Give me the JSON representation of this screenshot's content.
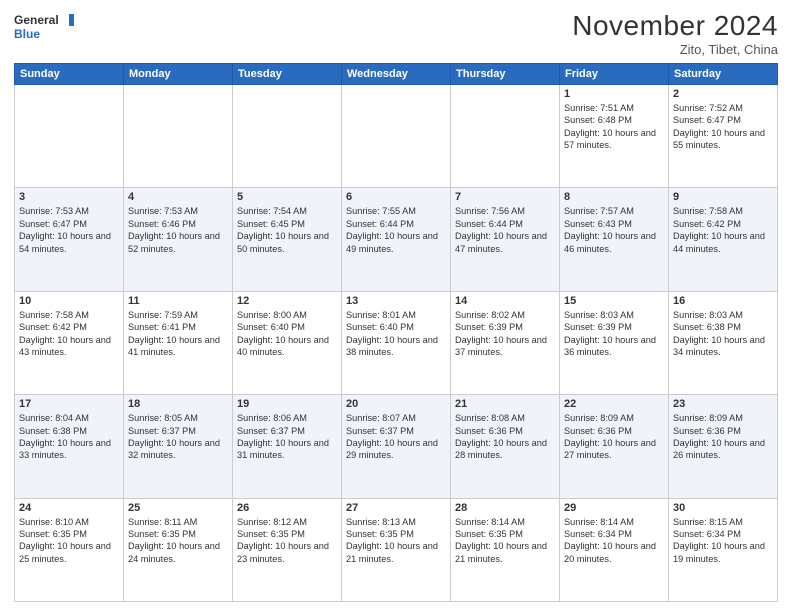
{
  "header": {
    "logo_line1": "General",
    "logo_line2": "Blue",
    "month_title": "November 2024",
    "location": "Zito, Tibet, China"
  },
  "days_of_week": [
    "Sunday",
    "Monday",
    "Tuesday",
    "Wednesday",
    "Thursday",
    "Friday",
    "Saturday"
  ],
  "weeks": [
    [
      {
        "day": "",
        "content": ""
      },
      {
        "day": "",
        "content": ""
      },
      {
        "day": "",
        "content": ""
      },
      {
        "day": "",
        "content": ""
      },
      {
        "day": "",
        "content": ""
      },
      {
        "day": "1",
        "content": "Sunrise: 7:51 AM\nSunset: 6:48 PM\nDaylight: 10 hours\nand 57 minutes."
      },
      {
        "day": "2",
        "content": "Sunrise: 7:52 AM\nSunset: 6:47 PM\nDaylight: 10 hours\nand 55 minutes."
      }
    ],
    [
      {
        "day": "3",
        "content": "Sunrise: 7:53 AM\nSunset: 6:47 PM\nDaylight: 10 hours\nand 54 minutes."
      },
      {
        "day": "4",
        "content": "Sunrise: 7:53 AM\nSunset: 6:46 PM\nDaylight: 10 hours\nand 52 minutes."
      },
      {
        "day": "5",
        "content": "Sunrise: 7:54 AM\nSunset: 6:45 PM\nDaylight: 10 hours\nand 50 minutes."
      },
      {
        "day": "6",
        "content": "Sunrise: 7:55 AM\nSunset: 6:44 PM\nDaylight: 10 hours\nand 49 minutes."
      },
      {
        "day": "7",
        "content": "Sunrise: 7:56 AM\nSunset: 6:44 PM\nDaylight: 10 hours\nand 47 minutes."
      },
      {
        "day": "8",
        "content": "Sunrise: 7:57 AM\nSunset: 6:43 PM\nDaylight: 10 hours\nand 46 minutes."
      },
      {
        "day": "9",
        "content": "Sunrise: 7:58 AM\nSunset: 6:42 PM\nDaylight: 10 hours\nand 44 minutes."
      }
    ],
    [
      {
        "day": "10",
        "content": "Sunrise: 7:58 AM\nSunset: 6:42 PM\nDaylight: 10 hours\nand 43 minutes."
      },
      {
        "day": "11",
        "content": "Sunrise: 7:59 AM\nSunset: 6:41 PM\nDaylight: 10 hours\nand 41 minutes."
      },
      {
        "day": "12",
        "content": "Sunrise: 8:00 AM\nSunset: 6:40 PM\nDaylight: 10 hours\nand 40 minutes."
      },
      {
        "day": "13",
        "content": "Sunrise: 8:01 AM\nSunset: 6:40 PM\nDaylight: 10 hours\nand 38 minutes."
      },
      {
        "day": "14",
        "content": "Sunrise: 8:02 AM\nSunset: 6:39 PM\nDaylight: 10 hours\nand 37 minutes."
      },
      {
        "day": "15",
        "content": "Sunrise: 8:03 AM\nSunset: 6:39 PM\nDaylight: 10 hours\nand 36 minutes."
      },
      {
        "day": "16",
        "content": "Sunrise: 8:03 AM\nSunset: 6:38 PM\nDaylight: 10 hours\nand 34 minutes."
      }
    ],
    [
      {
        "day": "17",
        "content": "Sunrise: 8:04 AM\nSunset: 6:38 PM\nDaylight: 10 hours\nand 33 minutes."
      },
      {
        "day": "18",
        "content": "Sunrise: 8:05 AM\nSunset: 6:37 PM\nDaylight: 10 hours\nand 32 minutes."
      },
      {
        "day": "19",
        "content": "Sunrise: 8:06 AM\nSunset: 6:37 PM\nDaylight: 10 hours\nand 31 minutes."
      },
      {
        "day": "20",
        "content": "Sunrise: 8:07 AM\nSunset: 6:37 PM\nDaylight: 10 hours\nand 29 minutes."
      },
      {
        "day": "21",
        "content": "Sunrise: 8:08 AM\nSunset: 6:36 PM\nDaylight: 10 hours\nand 28 minutes."
      },
      {
        "day": "22",
        "content": "Sunrise: 8:09 AM\nSunset: 6:36 PM\nDaylight: 10 hours\nand 27 minutes."
      },
      {
        "day": "23",
        "content": "Sunrise: 8:09 AM\nSunset: 6:36 PM\nDaylight: 10 hours\nand 26 minutes."
      }
    ],
    [
      {
        "day": "24",
        "content": "Sunrise: 8:10 AM\nSunset: 6:35 PM\nDaylight: 10 hours\nand 25 minutes."
      },
      {
        "day": "25",
        "content": "Sunrise: 8:11 AM\nSunset: 6:35 PM\nDaylight: 10 hours\nand 24 minutes."
      },
      {
        "day": "26",
        "content": "Sunrise: 8:12 AM\nSunset: 6:35 PM\nDaylight: 10 hours\nand 23 minutes."
      },
      {
        "day": "27",
        "content": "Sunrise: 8:13 AM\nSunset: 6:35 PM\nDaylight: 10 hours\nand 21 minutes."
      },
      {
        "day": "28",
        "content": "Sunrise: 8:14 AM\nSunset: 6:35 PM\nDaylight: 10 hours\nand 21 minutes."
      },
      {
        "day": "29",
        "content": "Sunrise: 8:14 AM\nSunset: 6:34 PM\nDaylight: 10 hours\nand 20 minutes."
      },
      {
        "day": "30",
        "content": "Sunrise: 8:15 AM\nSunset: 6:34 PM\nDaylight: 10 hours\nand 19 minutes."
      }
    ]
  ]
}
